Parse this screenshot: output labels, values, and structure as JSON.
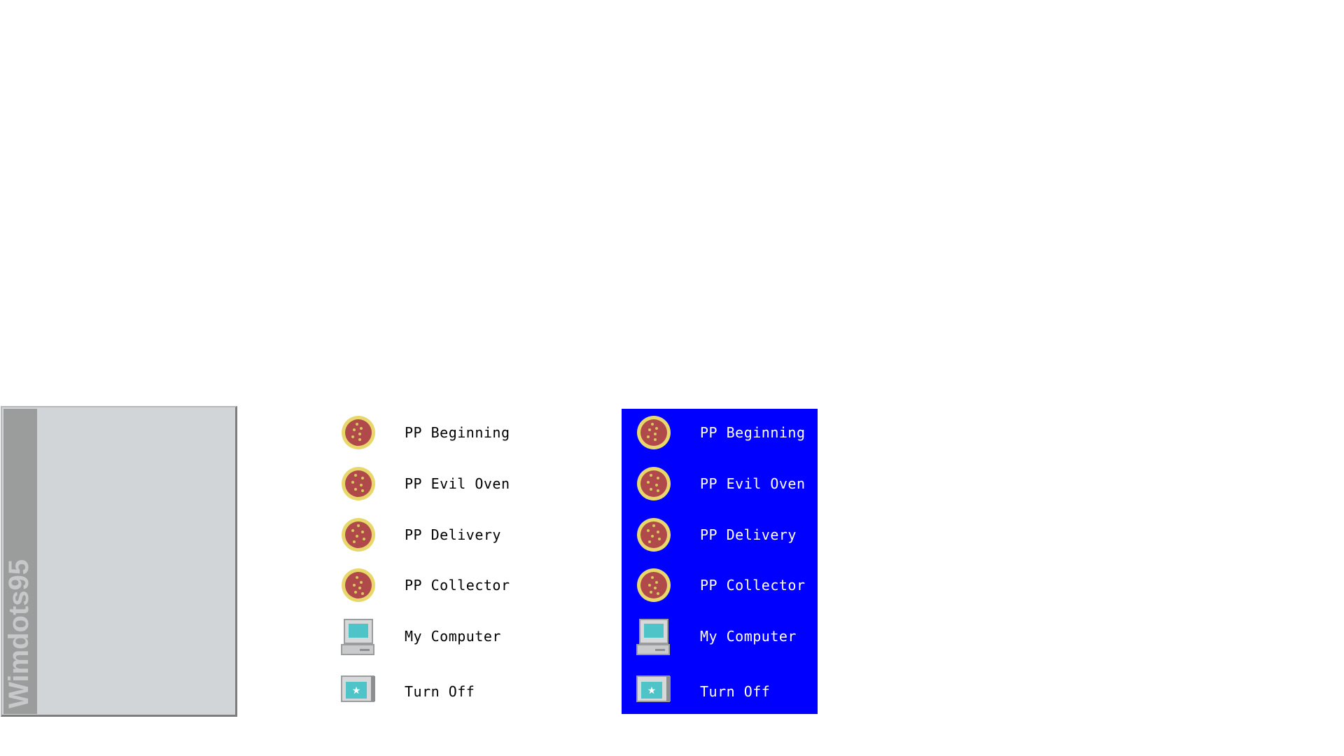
{
  "colors": {
    "panel_bg": "#d1d5d8",
    "sidebar_bg": "#9b9c9c",
    "brand_text": "#c6c8c9",
    "highlight_bg": "#0000ff",
    "highlight_text": "#ffffff",
    "text": "#000000"
  },
  "start_menu": {
    "brand": "Wimdots95"
  },
  "menu_plain": {
    "items": [
      {
        "label": "PP Beginning",
        "icon": "pizza-icon"
      },
      {
        "label": "PP Evil Oven",
        "icon": "pizza-icon"
      },
      {
        "label": "PP Delivery",
        "icon": "pizza-icon"
      },
      {
        "label": "PP Collector",
        "icon": "pizza-icon"
      },
      {
        "label": "My Computer",
        "icon": "computer-icon"
      },
      {
        "label": "Turn Off",
        "icon": "power-icon"
      }
    ]
  },
  "menu_highlighted": {
    "items": [
      {
        "label": "PP Beginning",
        "icon": "pizza-icon"
      },
      {
        "label": "PP Evil Oven",
        "icon": "pizza-icon"
      },
      {
        "label": "PP Delivery",
        "icon": "pizza-icon"
      },
      {
        "label": "PP Collector",
        "icon": "pizza-icon"
      },
      {
        "label": "My Computer",
        "icon": "computer-icon"
      },
      {
        "label": "Turn Off",
        "icon": "power-icon"
      }
    ]
  }
}
